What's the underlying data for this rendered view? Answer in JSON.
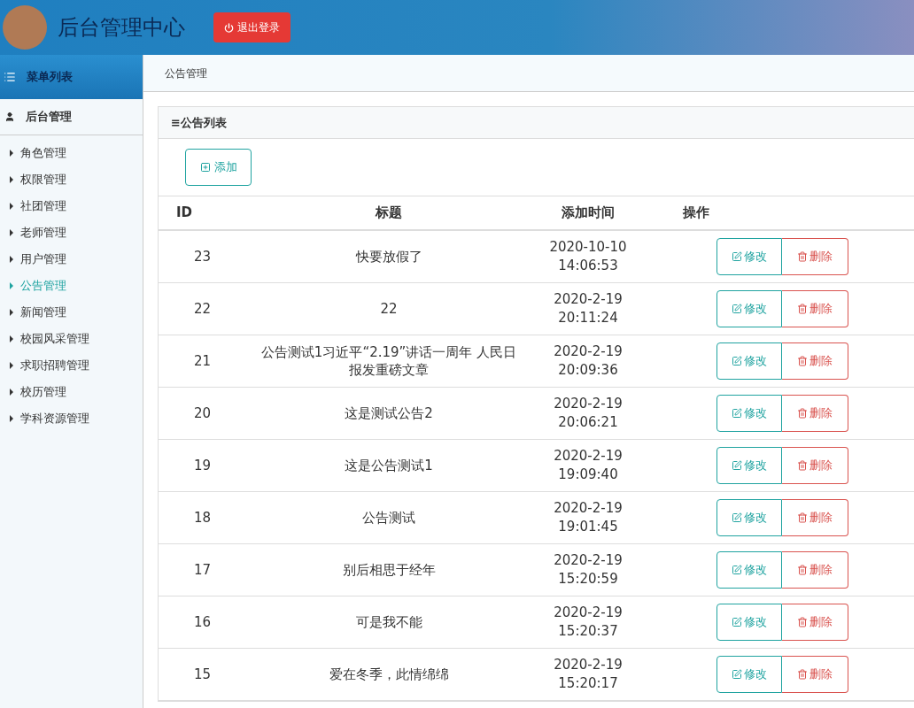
{
  "header": {
    "title": "后台管理中心",
    "logout": "退出登录"
  },
  "sidebar": {
    "title": "菜单列表",
    "group": "后台管理",
    "items": [
      {
        "label": "角色管理",
        "selected": false
      },
      {
        "label": "权限管理",
        "selected": false
      },
      {
        "label": "社团管理",
        "selected": false
      },
      {
        "label": "老师管理",
        "selected": false
      },
      {
        "label": "用户管理",
        "selected": false
      },
      {
        "label": "公告管理",
        "selected": true
      },
      {
        "label": "新闻管理",
        "selected": false
      },
      {
        "label": "校园风采管理",
        "selected": false
      },
      {
        "label": "求职招聘管理",
        "selected": false
      },
      {
        "label": "校历管理",
        "selected": false
      },
      {
        "label": "学科资源管理",
        "selected": false
      }
    ]
  },
  "breadcrumb": "公告管理",
  "panel": {
    "title": "≡公告列表",
    "add_button": "添加"
  },
  "table": {
    "columns": [
      "ID",
      "标题",
      "添加时间",
      "操作"
    ],
    "rows": [
      {
        "id": "23",
        "title": "快要放假了",
        "date": "2020-10-10",
        "time": "14:06:53",
        "edit": "修改",
        "delete": "删除"
      },
      {
        "id": "22",
        "title": "22",
        "date": "2020-2-19",
        "time": "20:11:24",
        "edit": "修改",
        "delete": "删除"
      },
      {
        "id": "21",
        "title": "公告测试1习近平“2.19”讲话一周年 人民日报发重磅文章",
        "date": "2020-2-19",
        "time": "20:09:36",
        "edit": "修改",
        "delete": "删除"
      },
      {
        "id": "20",
        "title": "这是测试公告2",
        "date": "2020-2-19",
        "time": "20:06:21",
        "edit": "修改",
        "delete": "删除"
      },
      {
        "id": "19",
        "title": "这是公告测试1",
        "date": "2020-2-19",
        "time": "19:09:40",
        "edit": "修改",
        "delete": "删除"
      },
      {
        "id": "18",
        "title": "公告测试",
        "date": "2020-2-19",
        "time": "19:01:45",
        "edit": "修改",
        "delete": "删除"
      },
      {
        "id": "17",
        "title": "别后相思于经年",
        "date": "2020-2-19",
        "time": "15:20:59",
        "edit": "修改",
        "delete": "删除"
      },
      {
        "id": "16",
        "title": "可是我不能",
        "date": "2020-2-19",
        "time": "15:20:37",
        "edit": "修改",
        "delete": "删除"
      },
      {
        "id": "15",
        "title": "爱在冬季，此情绵绵",
        "date": "2020-2-19",
        "time": "15:20:17",
        "edit": "修改",
        "delete": "删除"
      }
    ]
  }
}
